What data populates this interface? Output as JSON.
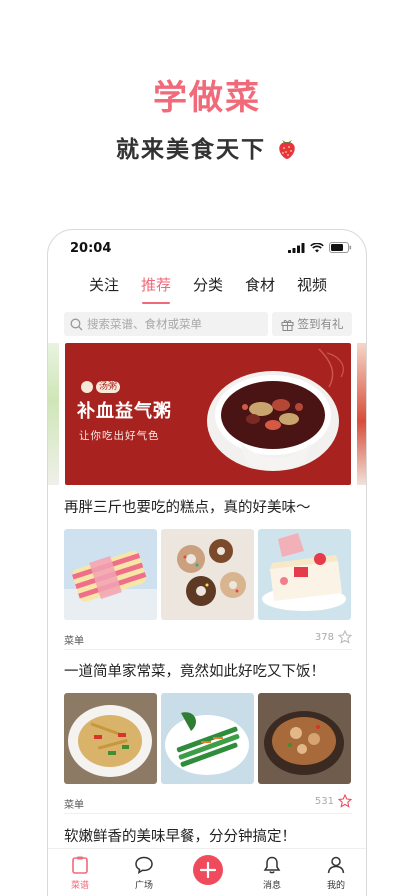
{
  "promo": {
    "title": "学做菜",
    "subtitle": "就来美食天下"
  },
  "status": {
    "time": "20:04"
  },
  "tabs": [
    {
      "label": "关注",
      "active": false
    },
    {
      "label": "推荐",
      "active": true
    },
    {
      "label": "分类",
      "active": false
    },
    {
      "label": "食材",
      "active": false
    },
    {
      "label": "视频",
      "active": false
    }
  ],
  "search": {
    "placeholder": "搜索菜谱、食材或菜单",
    "signin_label": "签到有礼"
  },
  "banner": {
    "badge": "汤粥",
    "title": "补血益气粥",
    "subtitle": "让你吃出好气色"
  },
  "articles": [
    {
      "title": "再胖三斤也要吃的糕点，真的好美味～",
      "category": "菜单",
      "likes": "378",
      "star_color": "#bbbbbb"
    },
    {
      "title": "一道简单家常菜，竟然如此好吃又下饭！",
      "category": "菜单",
      "likes": "531",
      "star_color": "#f04b5d"
    },
    {
      "title": "软嫩鲜香的美味早餐，分分钟搞定！"
    }
  ],
  "nav": [
    {
      "label": "菜谱",
      "icon": "recipe-icon",
      "active": true
    },
    {
      "label": "广场",
      "icon": "chat-bubble-icon",
      "active": false
    },
    {
      "label": "",
      "icon": "add-icon",
      "active": false
    },
    {
      "label": "消息",
      "icon": "bell-icon",
      "active": false
    },
    {
      "label": "我的",
      "icon": "profile-icon",
      "active": false
    }
  ],
  "colors": {
    "accent": "#f06a7a",
    "add_button": "#f04b5d",
    "banner_bg": "#a8231f"
  }
}
